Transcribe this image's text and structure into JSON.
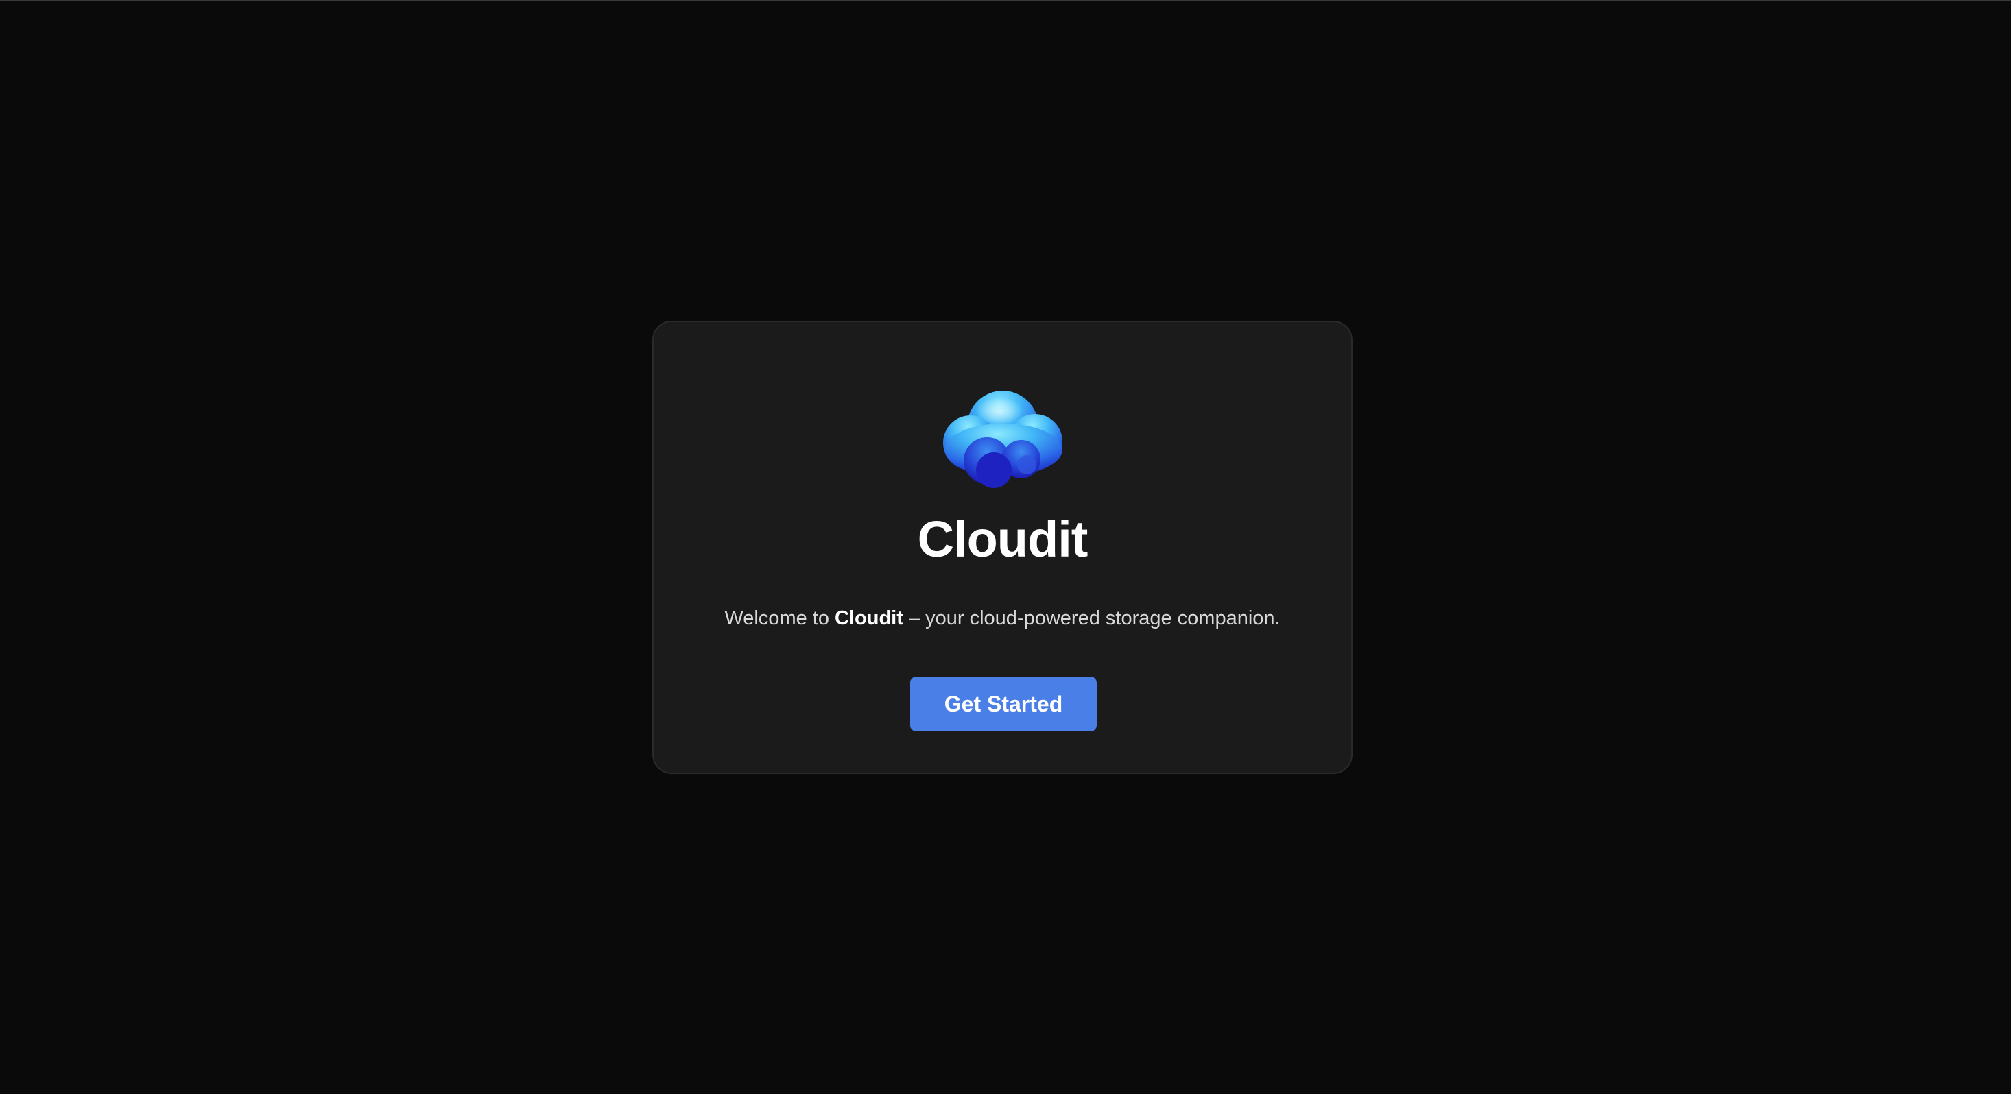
{
  "app": {
    "name": "Cloudit"
  },
  "welcome": {
    "title": "Cloudit",
    "tagline_prefix": "Welcome to ",
    "tagline_brand": "Cloudit",
    "tagline_suffix": " – your cloud-powered storage companion.",
    "logo_icon": "cloud-icon",
    "cta_label": "Get Started"
  },
  "colors": {
    "background": "#0a0a0a",
    "card": "#1b1b1b",
    "accent": "#4a7fe8",
    "cloud_light": "#7fdcff",
    "cloud_dark": "#1f2bd1"
  }
}
